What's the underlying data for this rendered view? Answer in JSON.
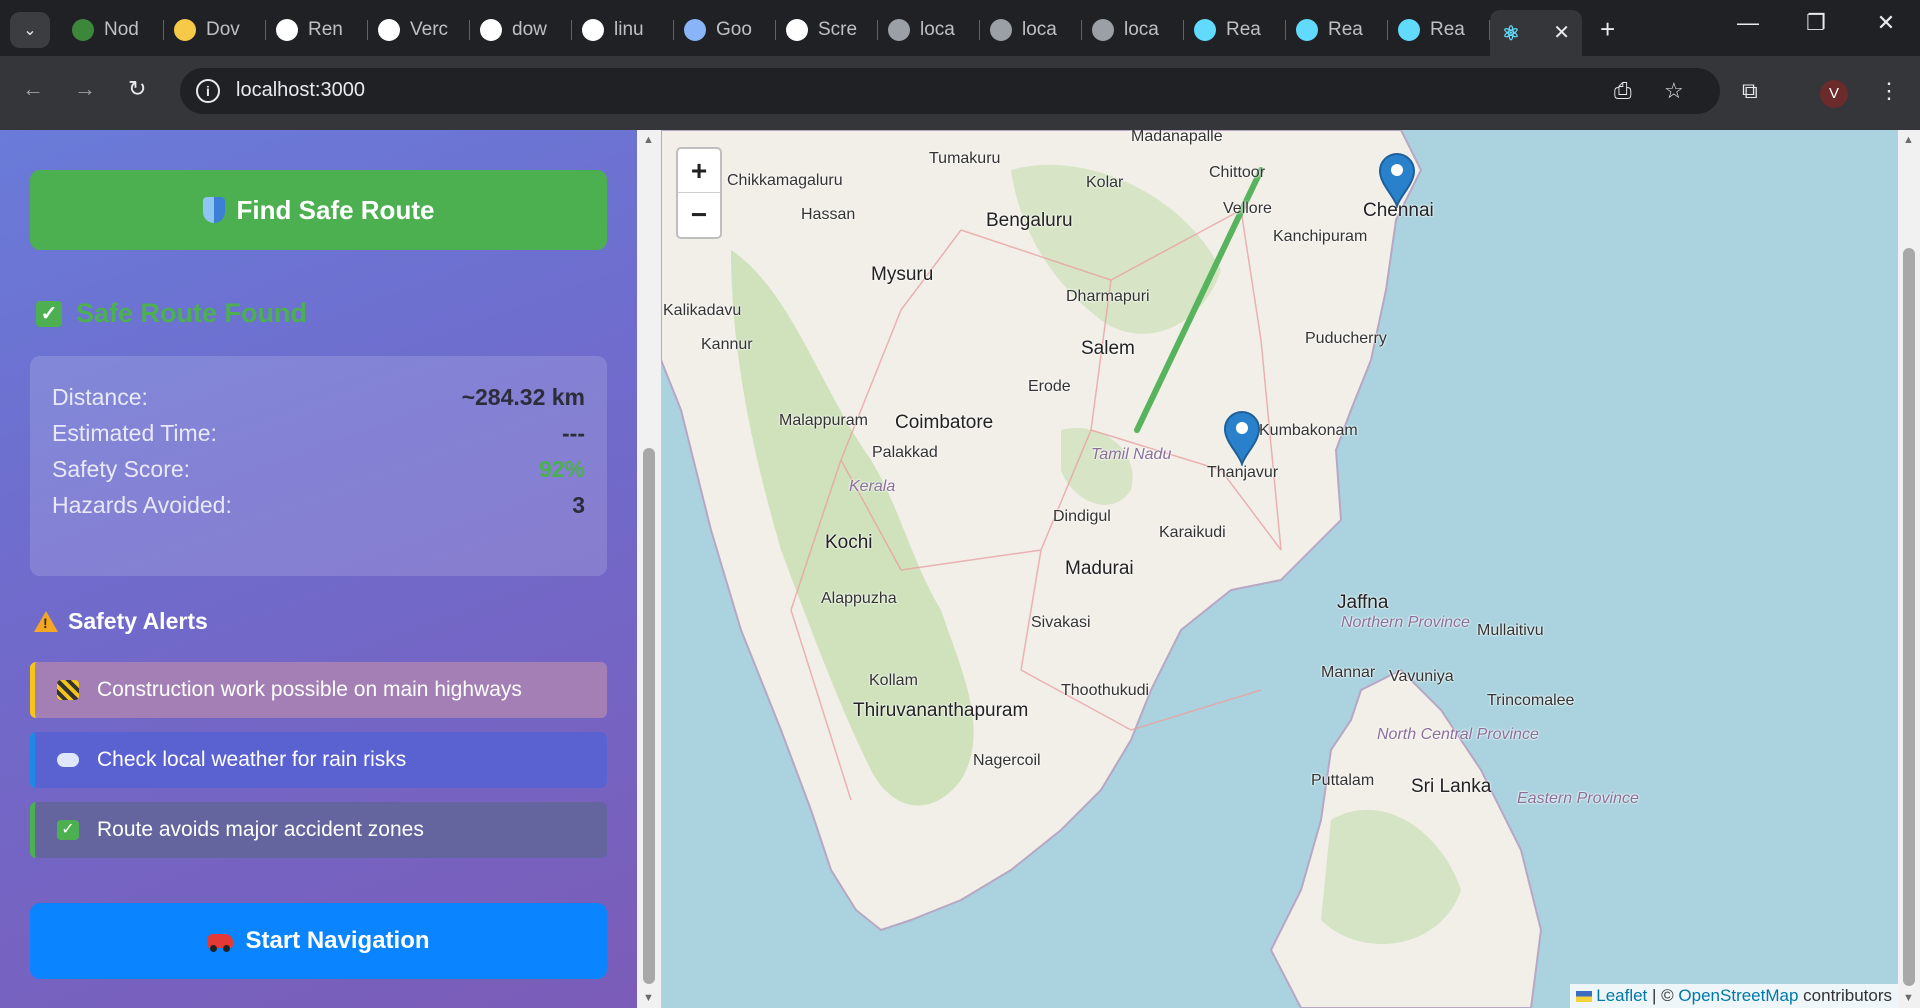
{
  "browser": {
    "tabs": [
      {
        "label": "Nod",
        "icon": "nodejs-icon",
        "color": "#3c873a"
      },
      {
        "label": "Dov",
        "icon": "python-icon",
        "color": "#f7c948"
      },
      {
        "label": "Ren",
        "icon": "render-icon",
        "color": "#ffffff"
      },
      {
        "label": "Verc",
        "icon": "vercel-icon",
        "color": "#ffffff"
      },
      {
        "label": "dow",
        "icon": "google-icon",
        "color": "#ffffff"
      },
      {
        "label": "linu",
        "icon": "google-icon",
        "color": "#ffffff"
      },
      {
        "label": "Goo",
        "icon": "gemini-icon",
        "color": "#8ab4f8"
      },
      {
        "label": "Scre",
        "icon": "screen-icon",
        "color": "#ffffff"
      },
      {
        "label": "loca",
        "icon": "globe-icon",
        "color": "#9aa0a6"
      },
      {
        "label": "loca",
        "icon": "globe-icon",
        "color": "#9aa0a6"
      },
      {
        "label": "loca",
        "icon": "globe-icon",
        "color": "#9aa0a6"
      },
      {
        "label": "Rea",
        "icon": "react-icon",
        "color": "#61dafb"
      },
      {
        "label": "Rea",
        "icon": "react-icon",
        "color": "#61dafb"
      },
      {
        "label": "Rea",
        "icon": "react-icon",
        "color": "#61dafb"
      }
    ],
    "url": "localhost:3000",
    "profile_initial": "V"
  },
  "sidebar": {
    "find_button": "Find Safe Route",
    "status": "Safe Route Found",
    "stats": [
      {
        "label": "Distance:",
        "value": "~284.32 km"
      },
      {
        "label": "Estimated Time:",
        "value": "---"
      },
      {
        "label": "Safety Score:",
        "value": "92%"
      },
      {
        "label": "Hazards Avoided:",
        "value": "3"
      }
    ],
    "alerts_title": "Safety Alerts",
    "alerts": [
      {
        "text": "Construction work possible on main highways",
        "icon": "construction-icon"
      },
      {
        "text": "Check local weather for rain risks",
        "icon": "cloud-icon"
      },
      {
        "text": "Route avoids major accident zones",
        "icon": "check-icon"
      }
    ],
    "nav_button": "Start Navigation"
  },
  "map": {
    "zoom_in": "+",
    "zoom_out": "−",
    "cities": [
      {
        "name": "Madanapalle"
      },
      {
        "name": "Tumakuru"
      },
      {
        "name": "Chikkamagaluru"
      },
      {
        "name": "Kolar"
      },
      {
        "name": "Chittoor"
      },
      {
        "name": "Chennai"
      },
      {
        "name": "Hassan"
      },
      {
        "name": "Bengaluru"
      },
      {
        "name": "Vellore"
      },
      {
        "name": "Kanchipuram"
      },
      {
        "name": "Mysuru"
      },
      {
        "name": "Kalikadavu"
      },
      {
        "name": "Dharmapuri"
      },
      {
        "name": "Kannur"
      },
      {
        "name": "Salem"
      },
      {
        "name": "Puducherry"
      },
      {
        "name": "Erode"
      },
      {
        "name": "Malappuram"
      },
      {
        "name": "Coimbatore"
      },
      {
        "name": "Kumbakonam"
      },
      {
        "name": "Palakkad"
      },
      {
        "name": "Tamil Nadu"
      },
      {
        "name": "Kerala"
      },
      {
        "name": "Thanjavur"
      },
      {
        "name": "Dindigul"
      },
      {
        "name": "Karaikudi"
      },
      {
        "name": "Kochi"
      },
      {
        "name": "Madurai"
      },
      {
        "name": "Jaffna"
      },
      {
        "name": "Alappuzha"
      },
      {
        "name": "Northern Province"
      },
      {
        "name": "Mullaitivu"
      },
      {
        "name": "Sivakasi"
      },
      {
        "name": "Mannar"
      },
      {
        "name": "Vavuniya"
      },
      {
        "name": "Kollam"
      },
      {
        "name": "Thoothukudi"
      },
      {
        "name": "Trincomalee"
      },
      {
        "name": "Thiruvananthapuram"
      },
      {
        "name": "North Central Province"
      },
      {
        "name": "Nagercoil"
      },
      {
        "name": "Puttalam"
      },
      {
        "name": "Sri Lanka"
      },
      {
        "name": "Eastern Province"
      }
    ],
    "attribution": {
      "leaflet": "Leaflet",
      "separator": "| ©",
      "osm": "OpenStreetMap",
      "suffix": "contributors"
    }
  }
}
